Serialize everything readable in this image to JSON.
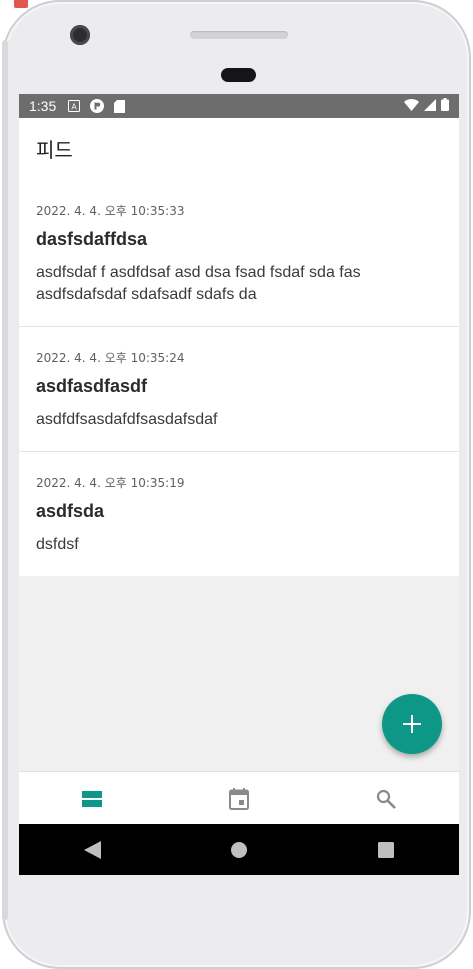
{
  "status_bar": {
    "time": "1:35",
    "icons": [
      "a-badge-icon",
      "p-badge-icon",
      "sd-card-icon",
      "wifi-icon",
      "signal-icon",
      "battery-icon"
    ]
  },
  "app_bar": {
    "title": "피드"
  },
  "posts": [
    {
      "date": "2022. 4. 4. 오후 10:35:33",
      "title": "dasfsdaffdsa",
      "body": "asdfsdaf f asdfdsaf asd dsa fsad fsdaf sda fas asdfsdafsdaf sdafsadf sdafs da"
    },
    {
      "date": "2022. 4. 4. 오후 10:35:24",
      "title": "asdfasdfasdf",
      "body": "asdfdfsasdafdfsasdafsdaf"
    },
    {
      "date": "2022. 4. 4. 오후 10:35:19",
      "title": "asdfsda",
      "body": "dsfdsf"
    }
  ],
  "fab": {
    "icon": "plus-icon",
    "color": "#0e9787"
  },
  "bottom_nav": {
    "items": [
      {
        "icon": "feed-icon",
        "active": true
      },
      {
        "icon": "calendar-icon",
        "active": false
      },
      {
        "icon": "search-icon",
        "active": false
      }
    ],
    "active_color": "#0e9787",
    "inactive_color": "#8a8a8a"
  },
  "system_nav": {
    "buttons": [
      "back-icon",
      "home-icon",
      "recents-icon"
    ]
  }
}
